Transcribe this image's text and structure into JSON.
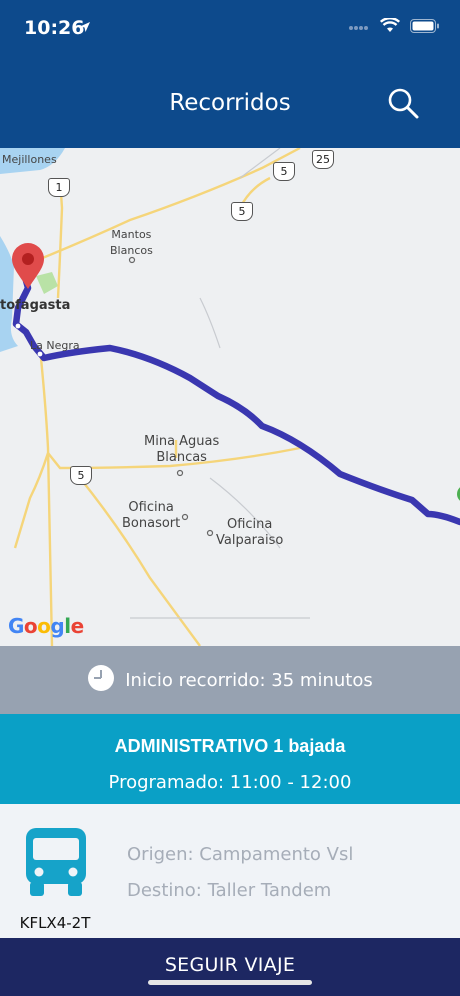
{
  "status": {
    "time": "10:26"
  },
  "header": {
    "title": "Recorridos"
  },
  "map": {
    "labels": {
      "mejillones": "Mejillones",
      "mantos_blancos": "Mantos\nBlancos",
      "antofagasta": "tofagasta",
      "la_negra": "La Negra",
      "mina_aguas_blancas": "Mina Aguas\nBlancas",
      "oficina_bonasort": "Oficina\nBonasort",
      "oficina_valparaiso": "Oficina\nValparaiso"
    },
    "shields": {
      "r1": "1",
      "r5a": "5",
      "r5b": "5",
      "r25": "25",
      "r5c": "5"
    },
    "attribution": "Google"
  },
  "info": {
    "text": "Inicio recorrido: 35 minutos"
  },
  "route": {
    "name": "ADMINISTRATIVO 1 bajada",
    "schedule": "Programado: 11:00 - 12:00"
  },
  "vehicle": {
    "plate": "KFLX4-2T",
    "origin": "Origen: Campamento Vsl",
    "destination": "Destino: Taller Tandem"
  },
  "footer": {
    "label": "SEGUIR VIAJE"
  },
  "colors": {
    "primary": "#0d4a8c",
    "route_line": "#3a37b0",
    "accent": "#0aa0c6",
    "footer": "#1d2762"
  }
}
